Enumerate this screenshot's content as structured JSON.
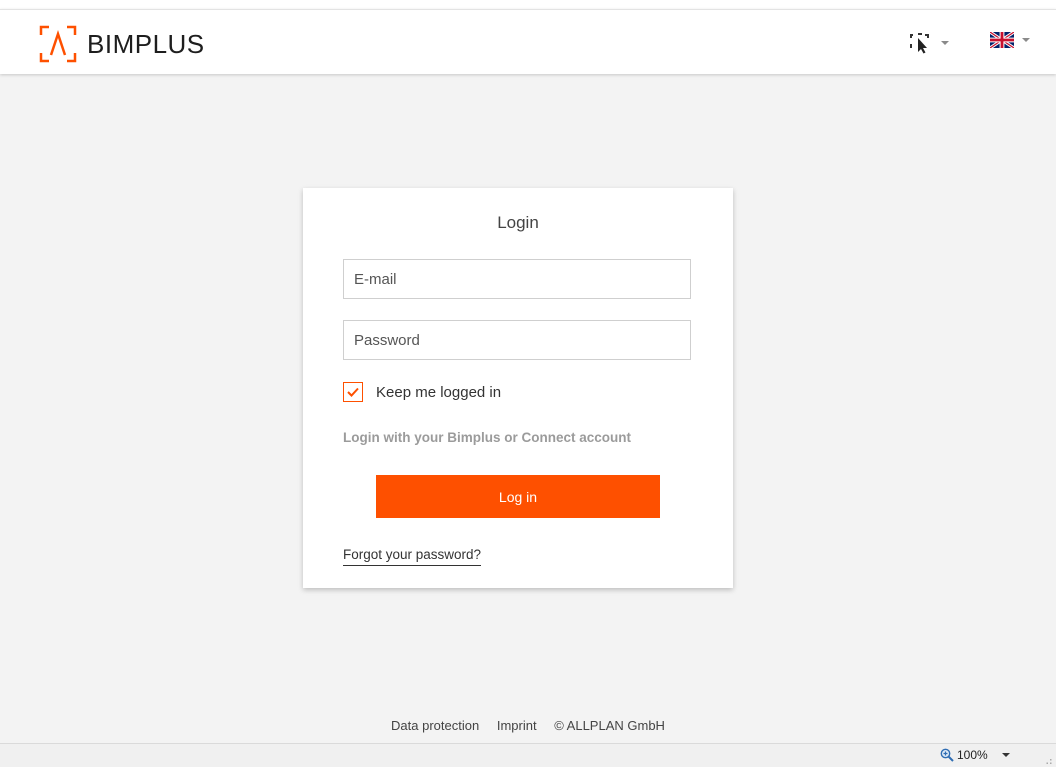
{
  "header": {
    "brand": "BIMPLUS",
    "logo_icon": "bimplus-logo-icon",
    "tool_icon": "selection-cursor-icon",
    "language_icon": "uk-flag-icon"
  },
  "login": {
    "title": "Login",
    "email_placeholder": "E-mail",
    "password_placeholder": "Password",
    "keep_logged_in": "Keep me logged in",
    "keep_logged_in_checked": true,
    "hint": "Login with your Bimplus or Connect account",
    "submit_label": "Log in",
    "forgot_link": "Forgot your password?"
  },
  "footer": {
    "data_protection": "Data protection",
    "imprint": "Imprint",
    "copyright": "© ALLPLAN GmbH"
  },
  "statusbar": {
    "zoom_level": "100%",
    "zoom_icon": "zoom-magnifier-icon"
  },
  "colors": {
    "accent": "#fe5000",
    "background": "#f3f3f3",
    "card": "#ffffff",
    "hint_text": "#9b9b9b"
  }
}
